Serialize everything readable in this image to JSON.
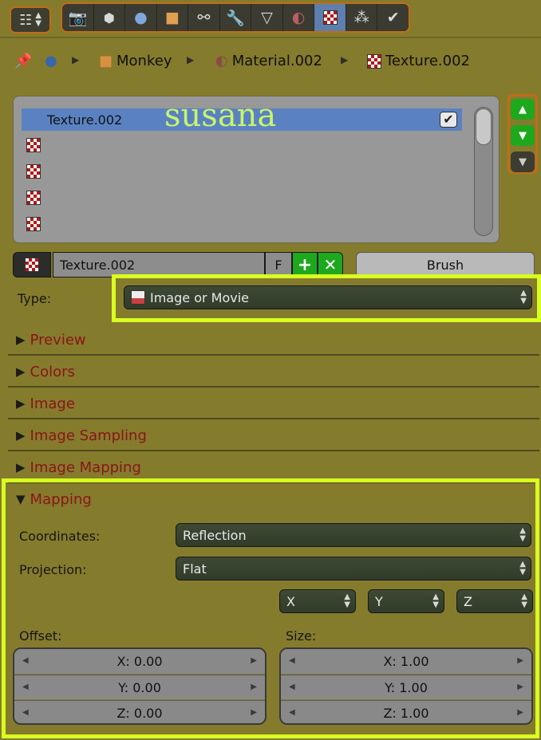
{
  "header": {
    "tabs": [
      "render-icon",
      "layers-icon",
      "world-icon",
      "object-icon",
      "constraints-icon",
      "modifiers-icon",
      "data-icon",
      "material-icon",
      "texture-icon",
      "particles-icon",
      "physics-icon"
    ],
    "active_tab": 8
  },
  "breadcrumb": {
    "items": [
      {
        "icon": "pin-icon"
      },
      {
        "icon": "scene-icon"
      },
      {
        "icon": "cube-icon",
        "label": "Monkey"
      },
      {
        "icon": "material-sphere-icon",
        "label": "Material.002"
      },
      {
        "icon": "texture-icon",
        "label": "Texture.002"
      }
    ]
  },
  "texture_slots": {
    "selected": "Texture.002",
    "annotation": "susana",
    "empty_rows": 4
  },
  "texture_id": {
    "name": "Texture.002",
    "fake_user": "F",
    "brush_label": "Brush"
  },
  "type": {
    "label": "Type:",
    "value": "Image or Movie"
  },
  "panels": {
    "collapsed": [
      "Preview",
      "Colors",
      "Image",
      "Image Sampling",
      "Image Mapping"
    ],
    "mapping": {
      "title": "Mapping",
      "coordinates_label": "Coordinates:",
      "coordinates_value": "Reflection",
      "projection_label": "Projection:",
      "projection_value": "Flat",
      "axis_x": "X",
      "axis_y": "Y",
      "axis_z": "Z",
      "offset_label": "Offset:",
      "size_label": "Size:",
      "offset": [
        "X: 0.00",
        "Y: 0.00",
        "Z: 0.00"
      ],
      "size": [
        "X: 1.00",
        "Y: 1.00",
        "Z: 1.00"
      ]
    }
  },
  "colors": {
    "background": "#857b2d",
    "highlight": "#d8ff20",
    "panel_title": "#8a1518",
    "selection": "#5a82c2",
    "green_button": "#1ea81e"
  }
}
